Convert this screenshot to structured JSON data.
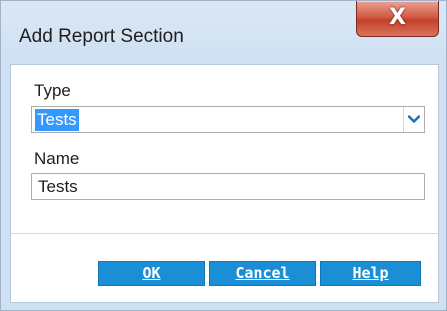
{
  "window": {
    "title": "Add Report Section",
    "close_symbol": "X"
  },
  "form": {
    "type_label": "Type",
    "type_value": "Tests",
    "type_arrow_icon": "chevron-down-icon",
    "name_label": "Name",
    "name_value": "Tests"
  },
  "buttons": {
    "ok_label": "OK",
    "cancel_label": "Cancel",
    "help_label": "Help"
  },
  "colors": {
    "button_bg": "#1a8fd6",
    "selection_bg": "#3399ff",
    "close_button": "#c2412b",
    "window_chrome": "#cfe0f1"
  }
}
